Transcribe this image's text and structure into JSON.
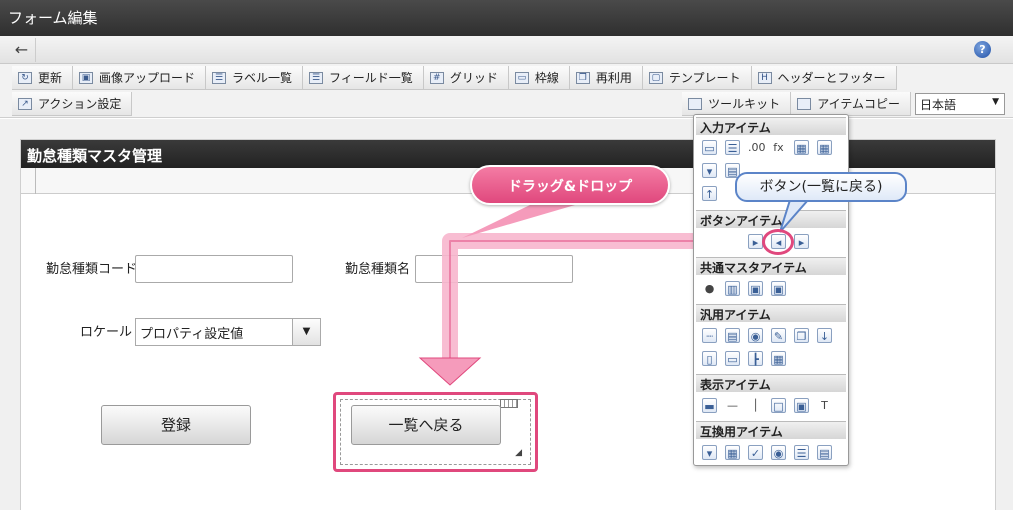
{
  "window": {
    "title": "フォーム編集"
  },
  "nav": {
    "back_icon": "←",
    "help_icon": "?"
  },
  "toolbar": {
    "row1": [
      {
        "label": "更新",
        "icon": "↻"
      },
      {
        "label": "画像アップロード",
        "icon": "▣"
      },
      {
        "label": "ラベル一覧",
        "icon": "☰"
      },
      {
        "label": "フィールド一覧",
        "icon": "☰"
      },
      {
        "label": "グリッド",
        "icon": "#"
      },
      {
        "label": "枠線",
        "icon": "▭"
      },
      {
        "label": "再利用",
        "icon": "❐"
      },
      {
        "label": "テンプレート",
        "icon": "▢"
      },
      {
        "label": "ヘッダーとフッター",
        "icon": "H"
      }
    ],
    "row2": [
      {
        "label": "アクション設定",
        "icon": "↗"
      }
    ],
    "toolkit_label": "ツールキット",
    "item_copy_label": "アイテムコピー",
    "language": "日本語"
  },
  "form": {
    "title": "勤怠種類マスタ管理",
    "labels": {
      "code": "勤怠種類コード",
      "name": "勤怠種類名",
      "locale": "ロケール"
    },
    "locale_value": "プロパティ設定値",
    "register_button": "登録",
    "back_button": "一覧へ戻る"
  },
  "palette": {
    "sections": [
      {
        "title": "入力アイテム"
      },
      {
        "title": "ボタンアイテム"
      },
      {
        "title": "共通マスタアイテム"
      },
      {
        "title": "汎用アイテム"
      },
      {
        "title": "表示アイテム"
      },
      {
        "title": "互換用アイテム"
      }
    ],
    "fx_label": "fx",
    "num_label": ".00"
  },
  "annotations": {
    "drag_drop": "ドラッグ&ドロップ",
    "callout": "ボタン(一覧に戻る)"
  },
  "colors": {
    "accent_pink": "#e0487d",
    "callout_blue": "#5b84c8",
    "titlebar": "#3a3a3a"
  }
}
